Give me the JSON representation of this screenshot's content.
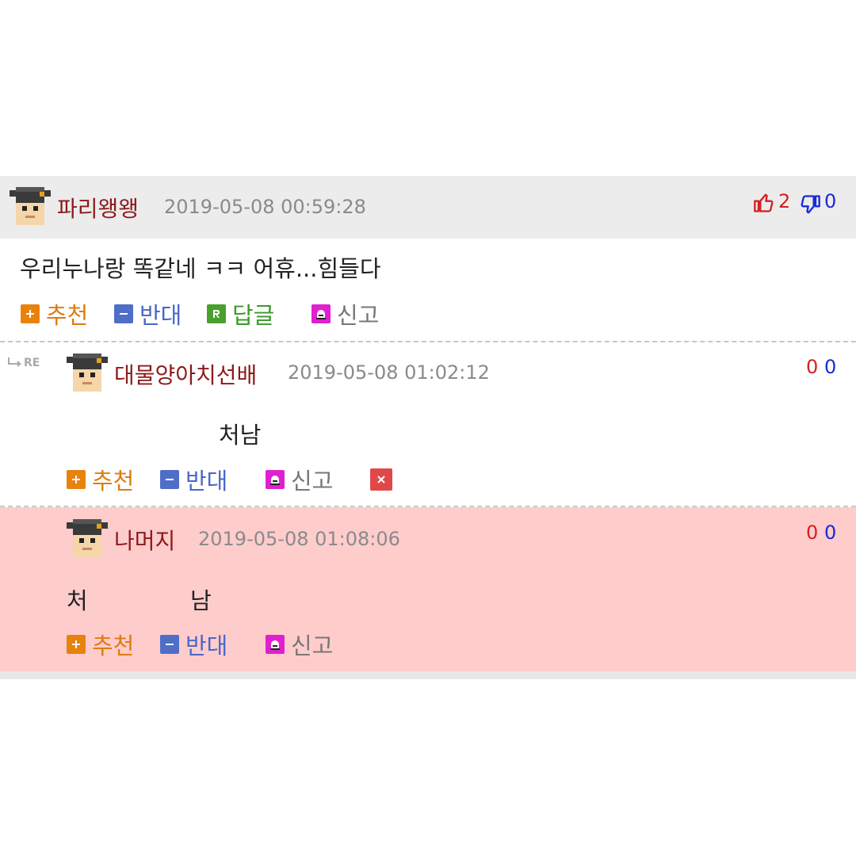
{
  "comments": [
    {
      "nickname": "파리왱왱",
      "timestamp": "2019-05-08 00:59:28",
      "body": "우리누나랑 똑같네 ㅋㅋ 어휴...힘들다",
      "upvotes": "2",
      "downvotes": "0"
    },
    {
      "nickname": "대물양아치선배",
      "timestamp": "2019-05-08 01:02:12",
      "body": "처남",
      "upvotes": "0",
      "downvotes": "0",
      "re_label": "RE"
    },
    {
      "nickname": "나머지",
      "timestamp": "2019-05-08 01:08:06",
      "body_part1": "처",
      "body_part2": "남",
      "upvotes": "0",
      "downvotes": "0"
    }
  ],
  "actions": {
    "recommend": "추천",
    "oppose": "반대",
    "reply": "답글",
    "report": "신고"
  },
  "icons": {
    "recommend": "plus-icon",
    "oppose": "minus-icon",
    "reply": "reply-r-icon",
    "report": "siren-icon",
    "delete": "close-x-icon",
    "thumbs_up": "thumbs-up-icon",
    "thumbs_down": "thumbs-down-icon"
  },
  "colors": {
    "highlight_bg": "#ffcccc",
    "nickname": "#8b1a1a",
    "recommend": "#e07b10",
    "oppose": "#4a67c8",
    "reply": "#3a9a2a",
    "report_icon": "#e020d0",
    "delete_icon": "#e04848"
  }
}
